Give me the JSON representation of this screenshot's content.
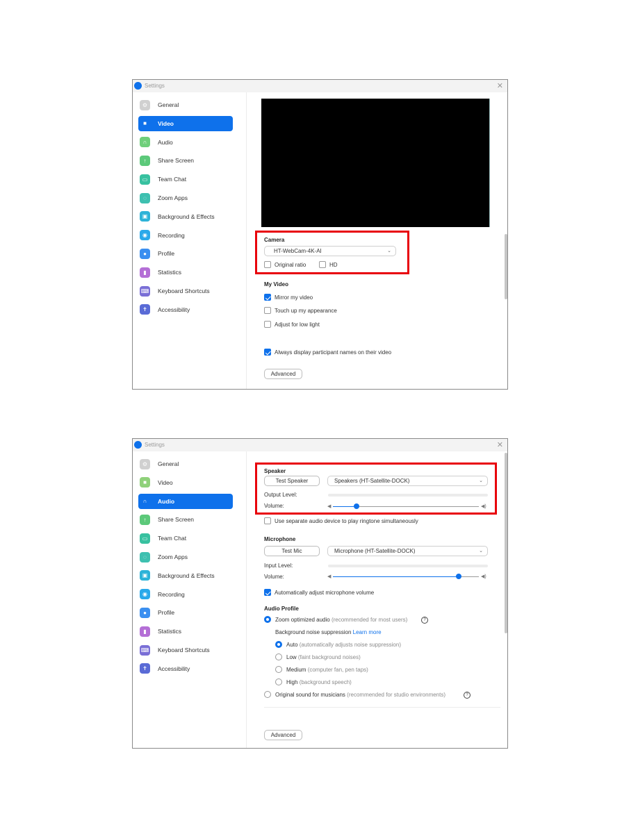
{
  "window_title": "Settings",
  "close_glyph": "✕",
  "sidebar": {
    "items": [
      {
        "label": "General",
        "icon": "gear-icon",
        "color": "#d0d0d0",
        "glyph": "⚙"
      },
      {
        "label": "Video",
        "icon": "video-camera-icon",
        "color": "#8fd17a",
        "glyph": "■"
      },
      {
        "label": "Audio",
        "icon": "headphones-icon",
        "color": "#6fcf7b",
        "glyph": "∩"
      },
      {
        "label": "Share Screen",
        "icon": "share-screen-icon",
        "color": "#5cc97a",
        "glyph": "↑"
      },
      {
        "label": "Team Chat",
        "icon": "chat-icon",
        "color": "#38c1a0",
        "glyph": "▭"
      },
      {
        "label": "Zoom Apps",
        "icon": "apps-icon",
        "color": "#3ec0b0",
        "glyph": "◌"
      },
      {
        "label": "Background & Effects",
        "icon": "background-icon",
        "color": "#2db3d8",
        "glyph": "▣"
      },
      {
        "label": "Recording",
        "icon": "recording-icon",
        "color": "#2aa9ea",
        "glyph": "◉"
      },
      {
        "label": "Profile",
        "icon": "profile-icon",
        "color": "#3b8ff0",
        "glyph": "●"
      },
      {
        "label": "Statistics",
        "icon": "statistics-icon",
        "color": "#b46fd6",
        "glyph": "▮"
      },
      {
        "label": "Keyboard Shortcuts",
        "icon": "keyboard-icon",
        "color": "#7a6fd6",
        "glyph": "⌨"
      },
      {
        "label": "Accessibility",
        "icon": "accessibility-icon",
        "color": "#5a6bd6",
        "glyph": "✝"
      }
    ]
  },
  "video_panel": {
    "active_item": "Video",
    "camera": {
      "heading": "Camera",
      "selected": "HT-WebCam-4K-AI",
      "original_ratio_label": "Original ratio",
      "original_ratio_checked": false,
      "hd_label": "HD",
      "hd_checked": false
    },
    "my_video": {
      "heading": "My Video",
      "options": [
        {
          "label": "Mirror my video",
          "checked": true
        },
        {
          "label": "Touch up my appearance",
          "checked": false
        },
        {
          "label": "Adjust for low light",
          "checked": false
        },
        {
          "label": "Always display participant names on their video",
          "checked": true
        }
      ]
    },
    "advanced_label": "Advanced"
  },
  "audio_panel": {
    "active_item": "Audio",
    "speaker": {
      "heading": "Speaker",
      "test_button": "Test Speaker",
      "device": "Speakers (HT-Satellite-DOCK)",
      "output_level_label": "Output Level:",
      "volume_label": "Volume:",
      "volume_fraction": 0.16
    },
    "ringtone": {
      "label": "Use separate audio device to play ringtone simultaneously",
      "checked": false
    },
    "microphone": {
      "heading": "Microphone",
      "test_button": "Test Mic",
      "device": "Microphone (HT-Satellite-DOCK)",
      "input_level_label": "Input Level:",
      "volume_label": "Volume:",
      "volume_fraction": 0.86,
      "auto_adjust_label": "Automatically adjust microphone volume",
      "auto_adjust_checked": true
    },
    "audio_profile": {
      "heading": "Audio Profile",
      "zoom_optimized": {
        "label": "Zoom optimized audio",
        "hint": "(recommended for most users)",
        "selected": true
      },
      "noise_suppression_label": "Background noise suppression",
      "learn_more": "Learn more",
      "levels": [
        {
          "label": "Auto",
          "hint": "(automatically adjusts noise suppression)",
          "selected": true
        },
        {
          "label": "Low",
          "hint": "(faint background noises)",
          "selected": false
        },
        {
          "label": "Medium",
          "hint": "(computer fan, pen taps)",
          "selected": false
        },
        {
          "label": "High",
          "hint": "(background speech)",
          "selected": false
        }
      ],
      "original_sound": {
        "label": "Original sound for musicians",
        "hint": "(recommended for studio environments)",
        "selected": false
      }
    },
    "advanced_label": "Advanced"
  },
  "colors": {
    "accent": "#0e71eb",
    "highlight_box": "#e8000b"
  }
}
